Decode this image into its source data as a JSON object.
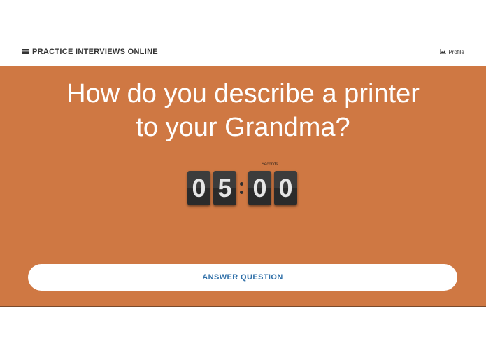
{
  "nav": {
    "brand_icon": "briefcase-icon",
    "brand": "PRACTICE INTERVIEWS ONLINE",
    "profile_icon": "chart-icon",
    "profile": "Profile"
  },
  "hero": {
    "question_line1": "How do you describe a printer",
    "question_line2": "to your Grandma?",
    "background_color": "#cf7843"
  },
  "timer": {
    "label": "Seconds",
    "digits": [
      "0",
      "5",
      "0",
      "0"
    ]
  },
  "answer_button": {
    "label": "ANSWER QUESTION",
    "text_color": "#2f6fa8"
  }
}
